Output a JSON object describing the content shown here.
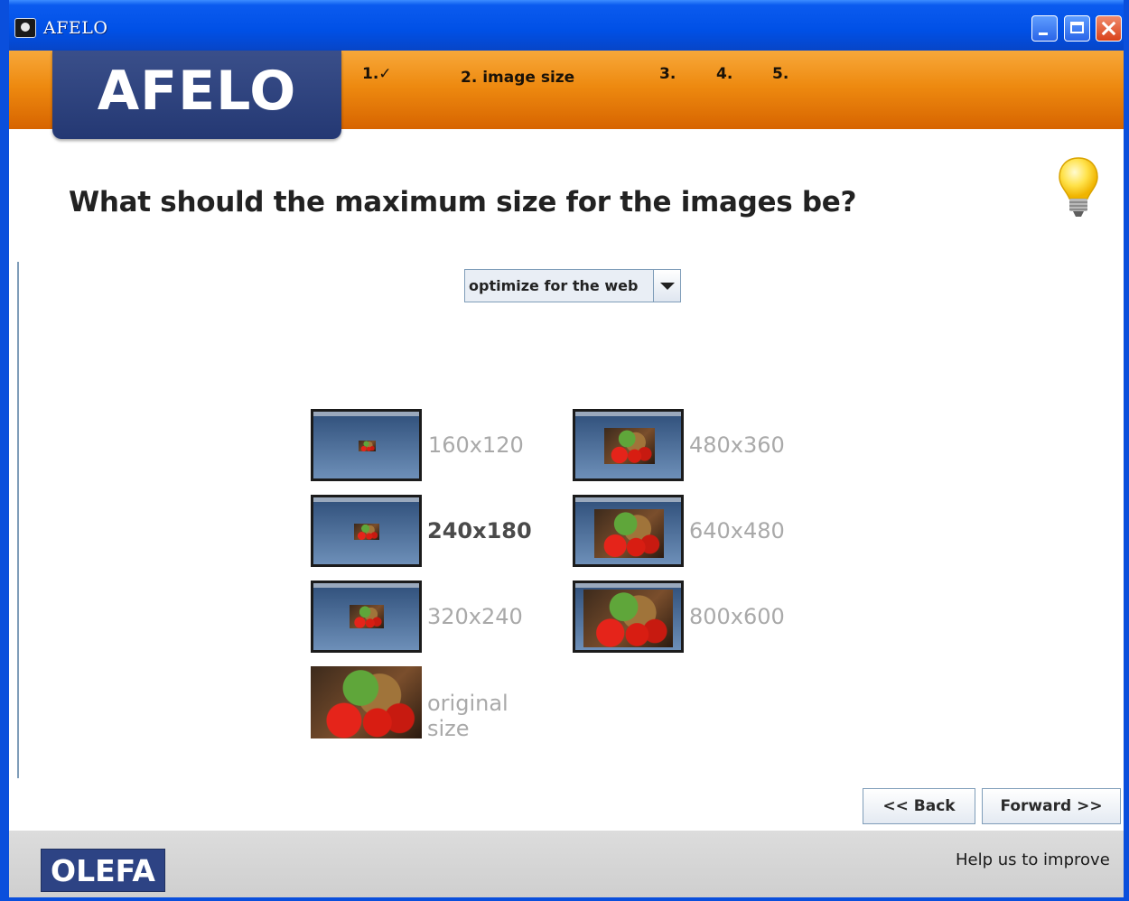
{
  "window": {
    "title": "AFELO"
  },
  "header": {
    "logo": "AFELO",
    "steps": [
      {
        "label": "1.✓"
      },
      {
        "label": "2. image size"
      },
      {
        "label": "3."
      },
      {
        "label": "4."
      },
      {
        "label": "5."
      }
    ]
  },
  "main": {
    "question": "What should the maximum size for the images be?",
    "preset_select": {
      "value": "optimize for the web"
    },
    "size_options": [
      {
        "label": "160x120",
        "selected": false
      },
      {
        "label": "480x360",
        "selected": false
      },
      {
        "label": "240x180",
        "selected": true
      },
      {
        "label": "640x480",
        "selected": false
      },
      {
        "label": "320x240",
        "selected": false
      },
      {
        "label": "800x600",
        "selected": false
      },
      {
        "label": "original size",
        "selected": false
      }
    ]
  },
  "nav": {
    "back": "<< Back",
    "forward": "Forward >>"
  },
  "footer": {
    "brand": "OLEFA",
    "help": "Help us to improve"
  },
  "colors": {
    "header_orange": "#ee8a10",
    "logo_blue": "#2d4384",
    "selected_text": "#4a4a4a",
    "unselected_text": "#a9a9a9"
  }
}
